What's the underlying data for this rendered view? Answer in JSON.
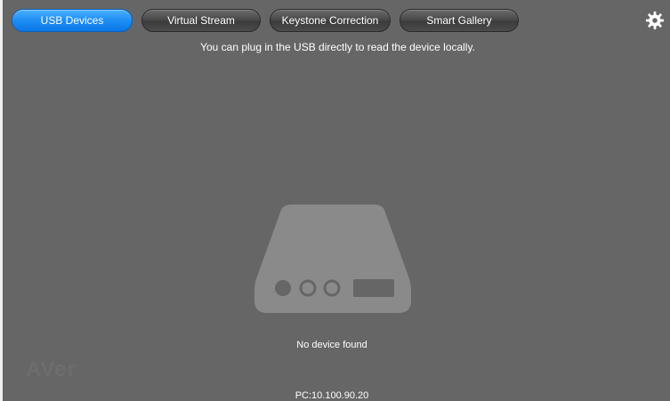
{
  "tabs": [
    {
      "label": "USB Devices",
      "active": true
    },
    {
      "label": "Virtual Stream",
      "active": false
    },
    {
      "label": "Keystone Correction",
      "active": false
    },
    {
      "label": "Smart Gallery",
      "active": false
    }
  ],
  "settings": {
    "icon": "gear-icon"
  },
  "hint_text": "You can plug in the USB directly to read the device locally.",
  "illustration": {
    "icon": "usb-drive-icon"
  },
  "status_text": "No device found",
  "pc_address": "PC:10.100.90.20",
  "watermark": "AVer",
  "colors": {
    "background": "#666666",
    "active_tab": "#1e8ef4",
    "inactive_tab": "#454545",
    "illustration": "#8a8a8a"
  }
}
